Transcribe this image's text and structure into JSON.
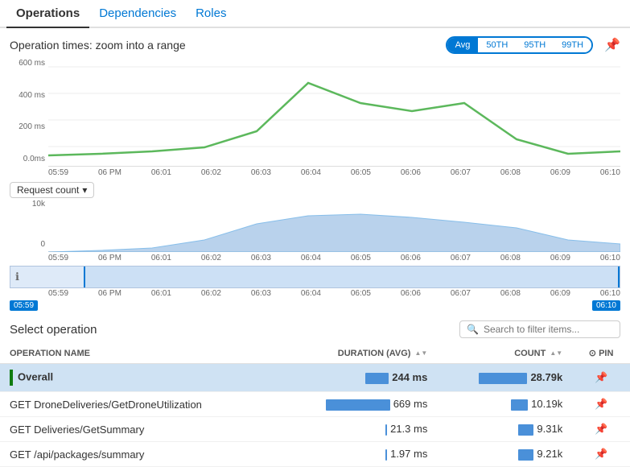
{
  "tabs": [
    {
      "label": "Operations",
      "active": true
    },
    {
      "label": "Dependencies",
      "active": false
    },
    {
      "label": "Roles",
      "active": false
    }
  ],
  "chart_section": {
    "title": "Operation times: zoom into a range",
    "metric_buttons": [
      "Avg",
      "50TH",
      "95TH",
      "99TH"
    ],
    "active_metric": "Avg",
    "y_labels": [
      "600 ms",
      "400 ms",
      "200 ms",
      "0.0ms"
    ],
    "time_labels": [
      "05:59",
      "06 PM",
      "06:01",
      "06:02",
      "06:03",
      "06:04",
      "06:05",
      "06:06",
      "06:07",
      "06:08",
      "06:09",
      "06:10"
    ],
    "request_dropdown": "Request count",
    "count_y_labels": [
      "10k",
      "0"
    ],
    "brush_start": "05:59",
    "brush_end": "06:10"
  },
  "select_operation": {
    "title": "Select operation",
    "search_placeholder": "Search to filter items..."
  },
  "table": {
    "columns": [
      {
        "label": "OPERATION NAME",
        "sortable": false
      },
      {
        "label": "DURATION (AVG)",
        "sortable": true
      },
      {
        "label": "COUNT",
        "sortable": true
      },
      {
        "label": "PIN",
        "sortable": false
      }
    ],
    "rows": [
      {
        "name": "Overall",
        "duration": "244 ms",
        "duration_pct": 36,
        "count": "28.79k",
        "count_pct": 100,
        "selected": true,
        "indicator": true
      },
      {
        "name": "GET DroneDeliveries/GetDroneUtilization",
        "duration": "669 ms",
        "duration_pct": 100,
        "count": "10.19k",
        "count_pct": 35,
        "selected": false,
        "indicator": false
      },
      {
        "name": "GET Deliveries/GetSummary",
        "duration": "21.3 ms",
        "duration_pct": 3,
        "count": "9.31k",
        "count_pct": 32,
        "selected": false,
        "indicator": false
      },
      {
        "name": "GET /api/packages/summary",
        "duration": "1.97 ms",
        "duration_pct": 0.5,
        "count": "9.21k",
        "count_pct": 32,
        "selected": false,
        "indicator": false
      }
    ]
  }
}
